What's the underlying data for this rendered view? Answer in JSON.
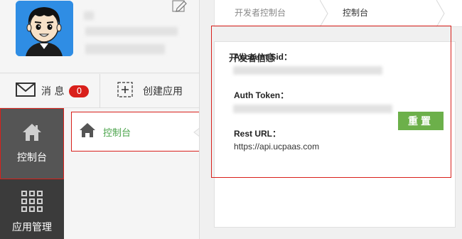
{
  "sidebar": {
    "actions": {
      "messages_label": "消 息",
      "messages_count": "0",
      "create_app_label": "创建应用"
    },
    "nav": [
      {
        "label": "控制台",
        "icon": "home-icon",
        "active": true
      },
      {
        "label": "应用管理",
        "icon": "grid-icon",
        "active": false
      }
    ],
    "subnav": [
      {
        "label": "控制台",
        "icon": "home-icon"
      }
    ]
  },
  "breadcrumb": [
    "开发者控制台",
    "控制台"
  ],
  "developer_info": {
    "title": "开发者信息",
    "account_sid_label": "Account Sid：",
    "auth_token_label": "Auth Token：",
    "rest_url_label": "Rest URL：",
    "rest_url_value": "https://api.ucpaas.com",
    "reset_label": "重置"
  },
  "colors": {
    "accent_green": "#6cb04a",
    "highlight_red": "#d9201b",
    "avatar_blue": "#2f8de4",
    "nav_dark": "#3b3b3b"
  }
}
